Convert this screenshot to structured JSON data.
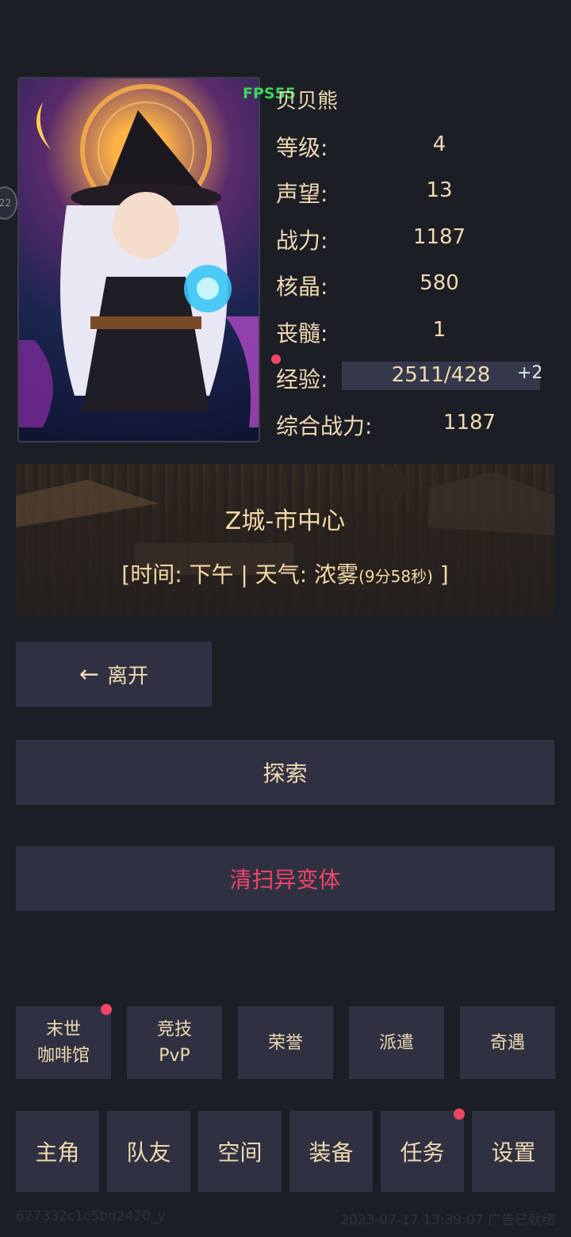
{
  "overlay": {
    "fps_label": "FPS55",
    "side_handle_text": "22"
  },
  "character": {
    "name": "贝贝熊",
    "stats": [
      {
        "label": "等级:",
        "value": "4"
      },
      {
        "label": "声望:",
        "value": "13"
      },
      {
        "label": "战力:",
        "value": "1187"
      },
      {
        "label": "核晶:",
        "value": "580"
      },
      {
        "label": "丧髓:",
        "value": "1"
      }
    ],
    "exp": {
      "label": "经验:",
      "value": "2511/428",
      "bonus": "+2"
    },
    "total_power": {
      "label": "综合战力:",
      "value": "1187"
    }
  },
  "location": {
    "title": "Z城-市中心",
    "info_prefix": "[时间: 下午 | 天气: 浓雾",
    "info_timer": "(9分58秒)",
    "info_suffix": "]"
  },
  "actions": {
    "leave_label": "离开",
    "explore_label": "探索",
    "cleanse_label": "清扫异变体"
  },
  "menu_row1": [
    {
      "line1": "末世",
      "line2": "咖啡馆",
      "has_dot": true
    },
    {
      "line1": "竞技",
      "line2": "PvP",
      "has_dot": false
    },
    {
      "line1": "荣誉",
      "line2": "",
      "has_dot": false
    },
    {
      "line1": "派遣",
      "line2": "",
      "has_dot": false
    },
    {
      "line1": "奇遇",
      "line2": "",
      "has_dot": false
    }
  ],
  "menu_row2": [
    {
      "label": "主角",
      "has_dot": false
    },
    {
      "label": "队友",
      "has_dot": false
    },
    {
      "label": "空间",
      "has_dot": false
    },
    {
      "label": "装备",
      "has_dot": false
    },
    {
      "label": "任务",
      "has_dot": true
    },
    {
      "label": "设置",
      "has_dot": false
    }
  ],
  "footer": {
    "device_id": "627332c1c5bd2420_y",
    "timestamp_status": "2023-07-17 13:39:07 广告已就绪"
  },
  "colors": {
    "background": "#1c1e26",
    "button": "#2f3142",
    "text": "#f0d9b0",
    "accent_red": "#ef4565",
    "fps_green": "#3cd65a"
  }
}
